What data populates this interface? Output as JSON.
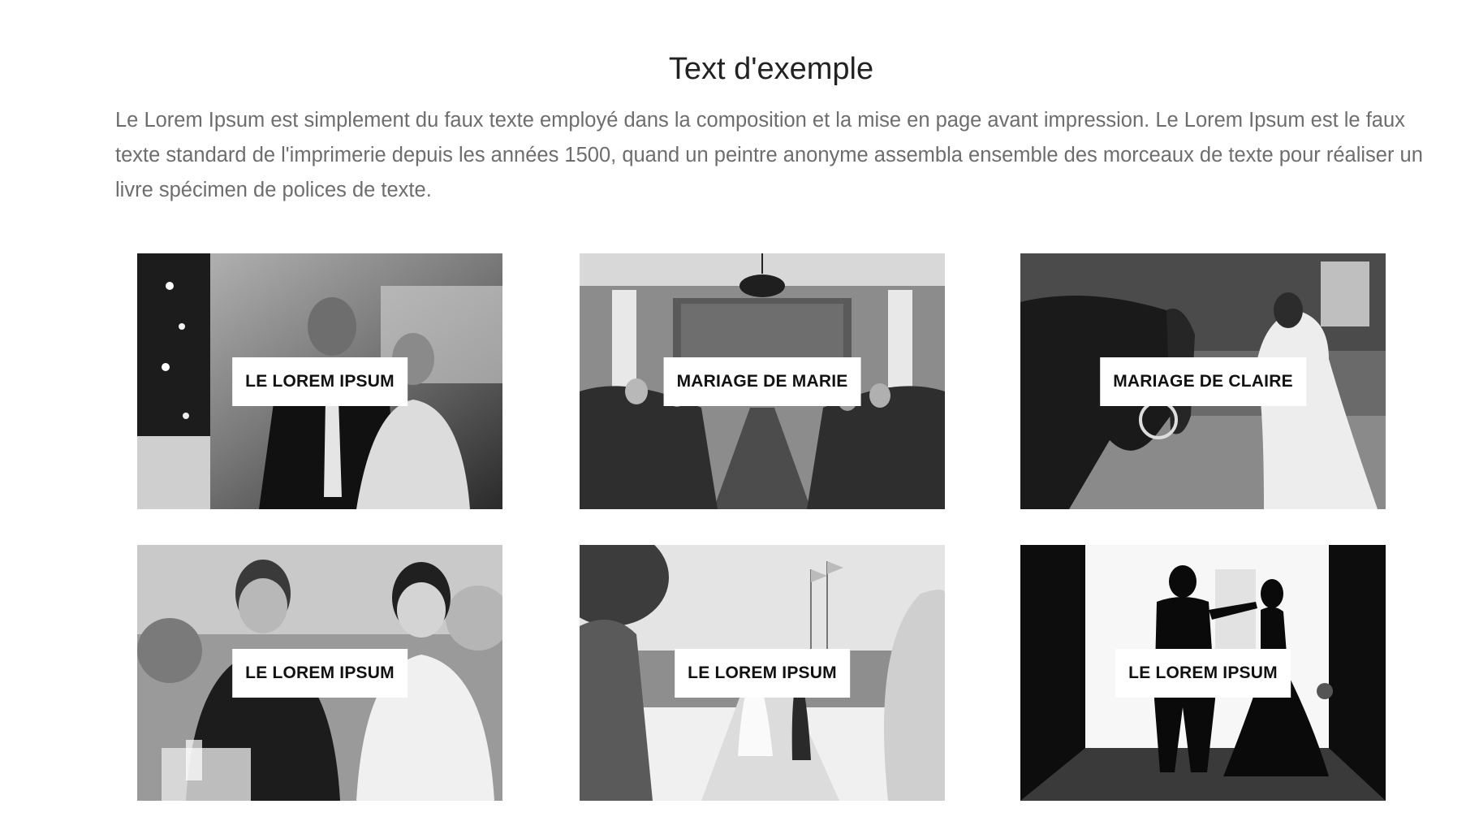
{
  "section": {
    "title": "Text d'exemple",
    "description": "Le Lorem Ipsum est simplement du faux texte employé dans la composition et la mise en page avant impression. Le Lorem Ipsum est le faux texte standard de l'imprimerie depuis les années 1500, quand un peintre anonyme assembla ensemble des morceaux de texte pour réaliser un livre spécimen de polices de texte."
  },
  "gallery": {
    "items": [
      {
        "label": "LE LOREM IPSUM"
      },
      {
        "label": "MARIAGE DE MARIE"
      },
      {
        "label": "MARIAGE DE CLAIRE"
      },
      {
        "label": "LE LOREM IPSUM"
      },
      {
        "label": "LE LOREM IPSUM"
      },
      {
        "label": "LE LOREM IPSUM"
      }
    ]
  }
}
